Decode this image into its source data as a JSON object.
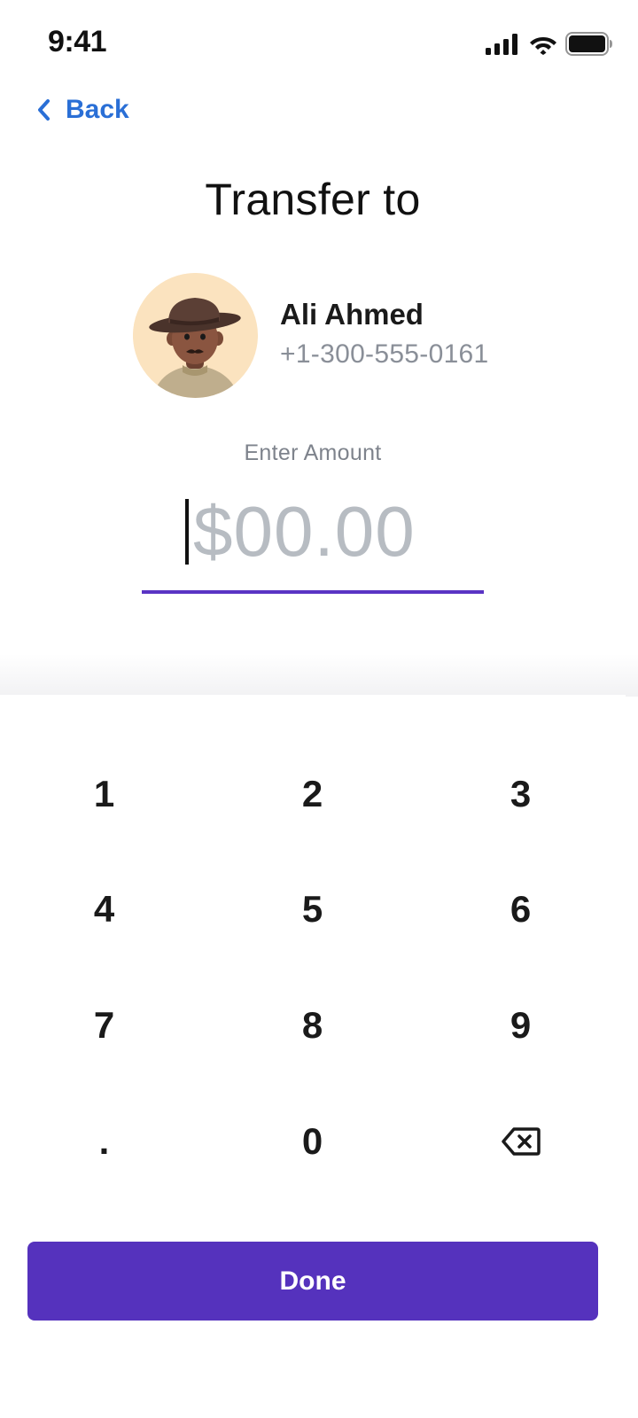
{
  "status_bar": {
    "time": "9:41"
  },
  "nav": {
    "back_label": "Back"
  },
  "page": {
    "title": "Transfer to"
  },
  "recipient": {
    "name": "Ali Ahmed",
    "phone": "+1-300-555-0161"
  },
  "amount": {
    "label": "Enter Amount",
    "placeholder": "$00.00",
    "value": ""
  },
  "keypad": {
    "keys": [
      "1",
      "2",
      "3",
      "4",
      "5",
      "6",
      "7",
      "8",
      "9",
      ".",
      "0"
    ],
    "backspace_icon": "backspace-icon"
  },
  "actions": {
    "done_label": "Done"
  },
  "colors": {
    "accent": "#5532bd",
    "link": "#2a6fd6",
    "underline": "#5a34c4",
    "placeholder": "#b7bcc2",
    "muted_text": "#8a8f98",
    "avatar_bg": "#fbe3bf"
  }
}
